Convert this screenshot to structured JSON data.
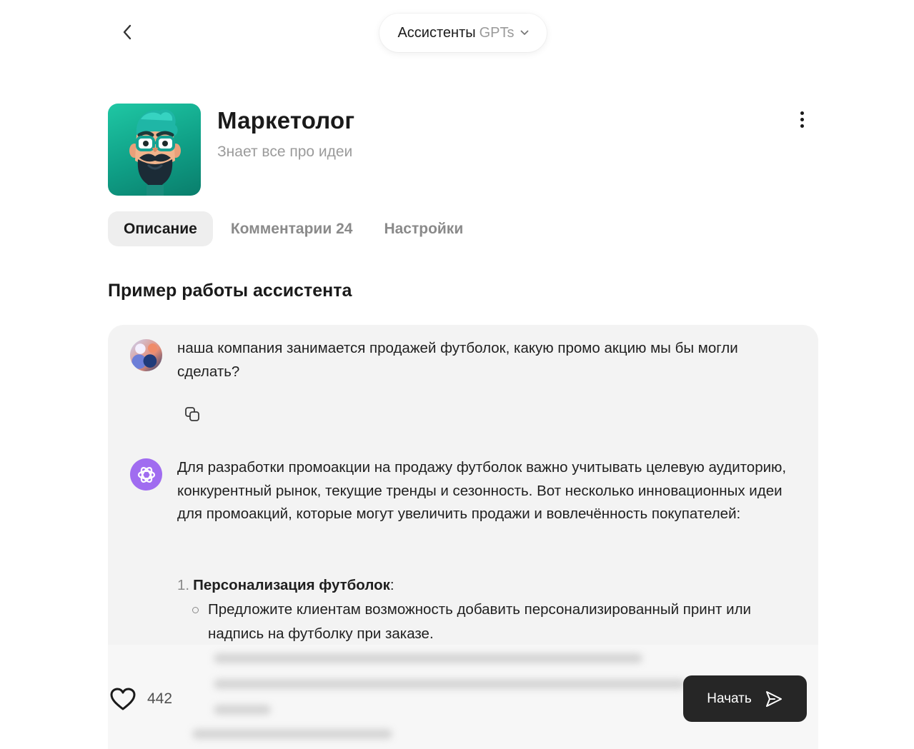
{
  "header": {
    "switcher_main": "Ассистенты",
    "switcher_sub": "GPTs"
  },
  "assistant": {
    "name": "Маркетолог",
    "tagline": "Знает все про идеи"
  },
  "tabs": [
    {
      "label": "Описание",
      "active": true
    },
    {
      "label": "Комментарии 24",
      "active": false
    },
    {
      "label": "Настройки",
      "active": false
    }
  ],
  "section": {
    "title": "Пример работы ассистента"
  },
  "chat": {
    "user_message": "наша компания занимается продажей футболок, какую промо акцию мы бы могли сделать?",
    "bot_intro": "Для разработки промоакции на продажу футболок важно учитывать целевую аудиторию, конкурентный рынок, текущие тренды и сезонность. Вот несколько инновационных идеи для промоакций, которые могут увеличить продажи и вовлечённость покупателей:",
    "list": [
      {
        "num": "1.",
        "title": "Персонализация футболок",
        "suffix": ":",
        "items": [
          "Предложите клиентам возможность добавить персонализированный принт или надпись на футболку при заказе."
        ]
      }
    ]
  },
  "footer": {
    "likes": "442",
    "start_label": "Начать"
  },
  "colors": {
    "bot_avatar": "#a06cf0",
    "start_button": "#262626",
    "card_background": "#f3f3f3",
    "avatar_gradient": "#10a88e"
  },
  "icons": [
    "back-icon",
    "chevron-down-icon",
    "more-icon",
    "copy-icon",
    "openai-icon",
    "heart-icon",
    "send-icon"
  ]
}
